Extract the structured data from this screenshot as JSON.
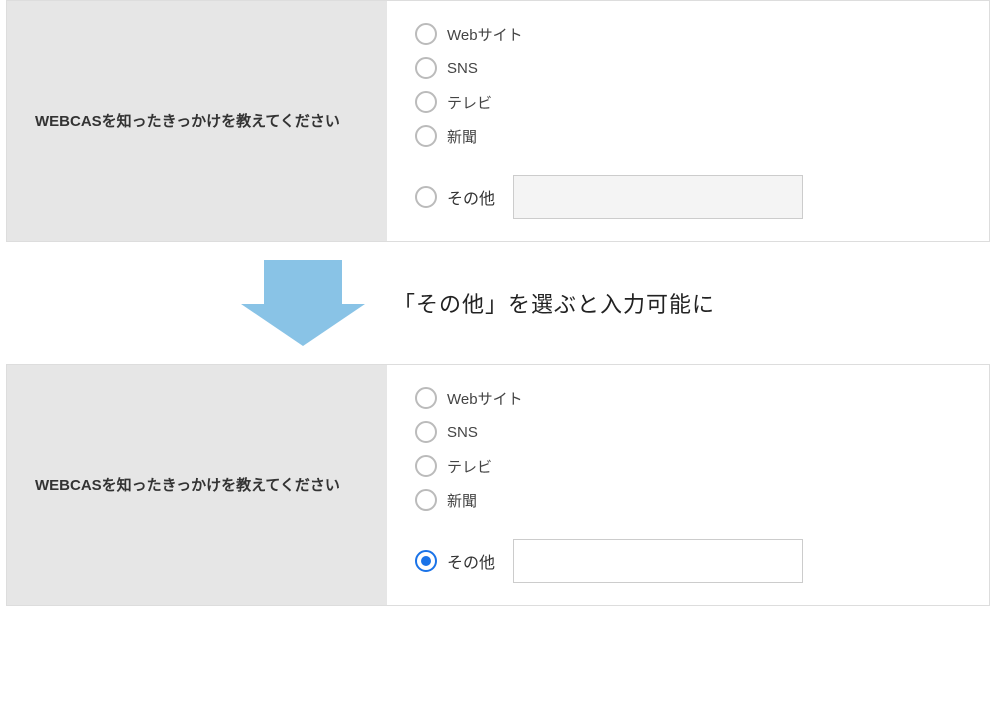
{
  "question_label": "WEBCASを知ったきっかけを教えてください",
  "options": {
    "website": "Webサイト",
    "sns": "SNS",
    "tv": "テレビ",
    "newspaper": "新聞",
    "other": "その他"
  },
  "arrow_caption": "「その他」を選ぶと入力可能に",
  "other_input_value": ""
}
